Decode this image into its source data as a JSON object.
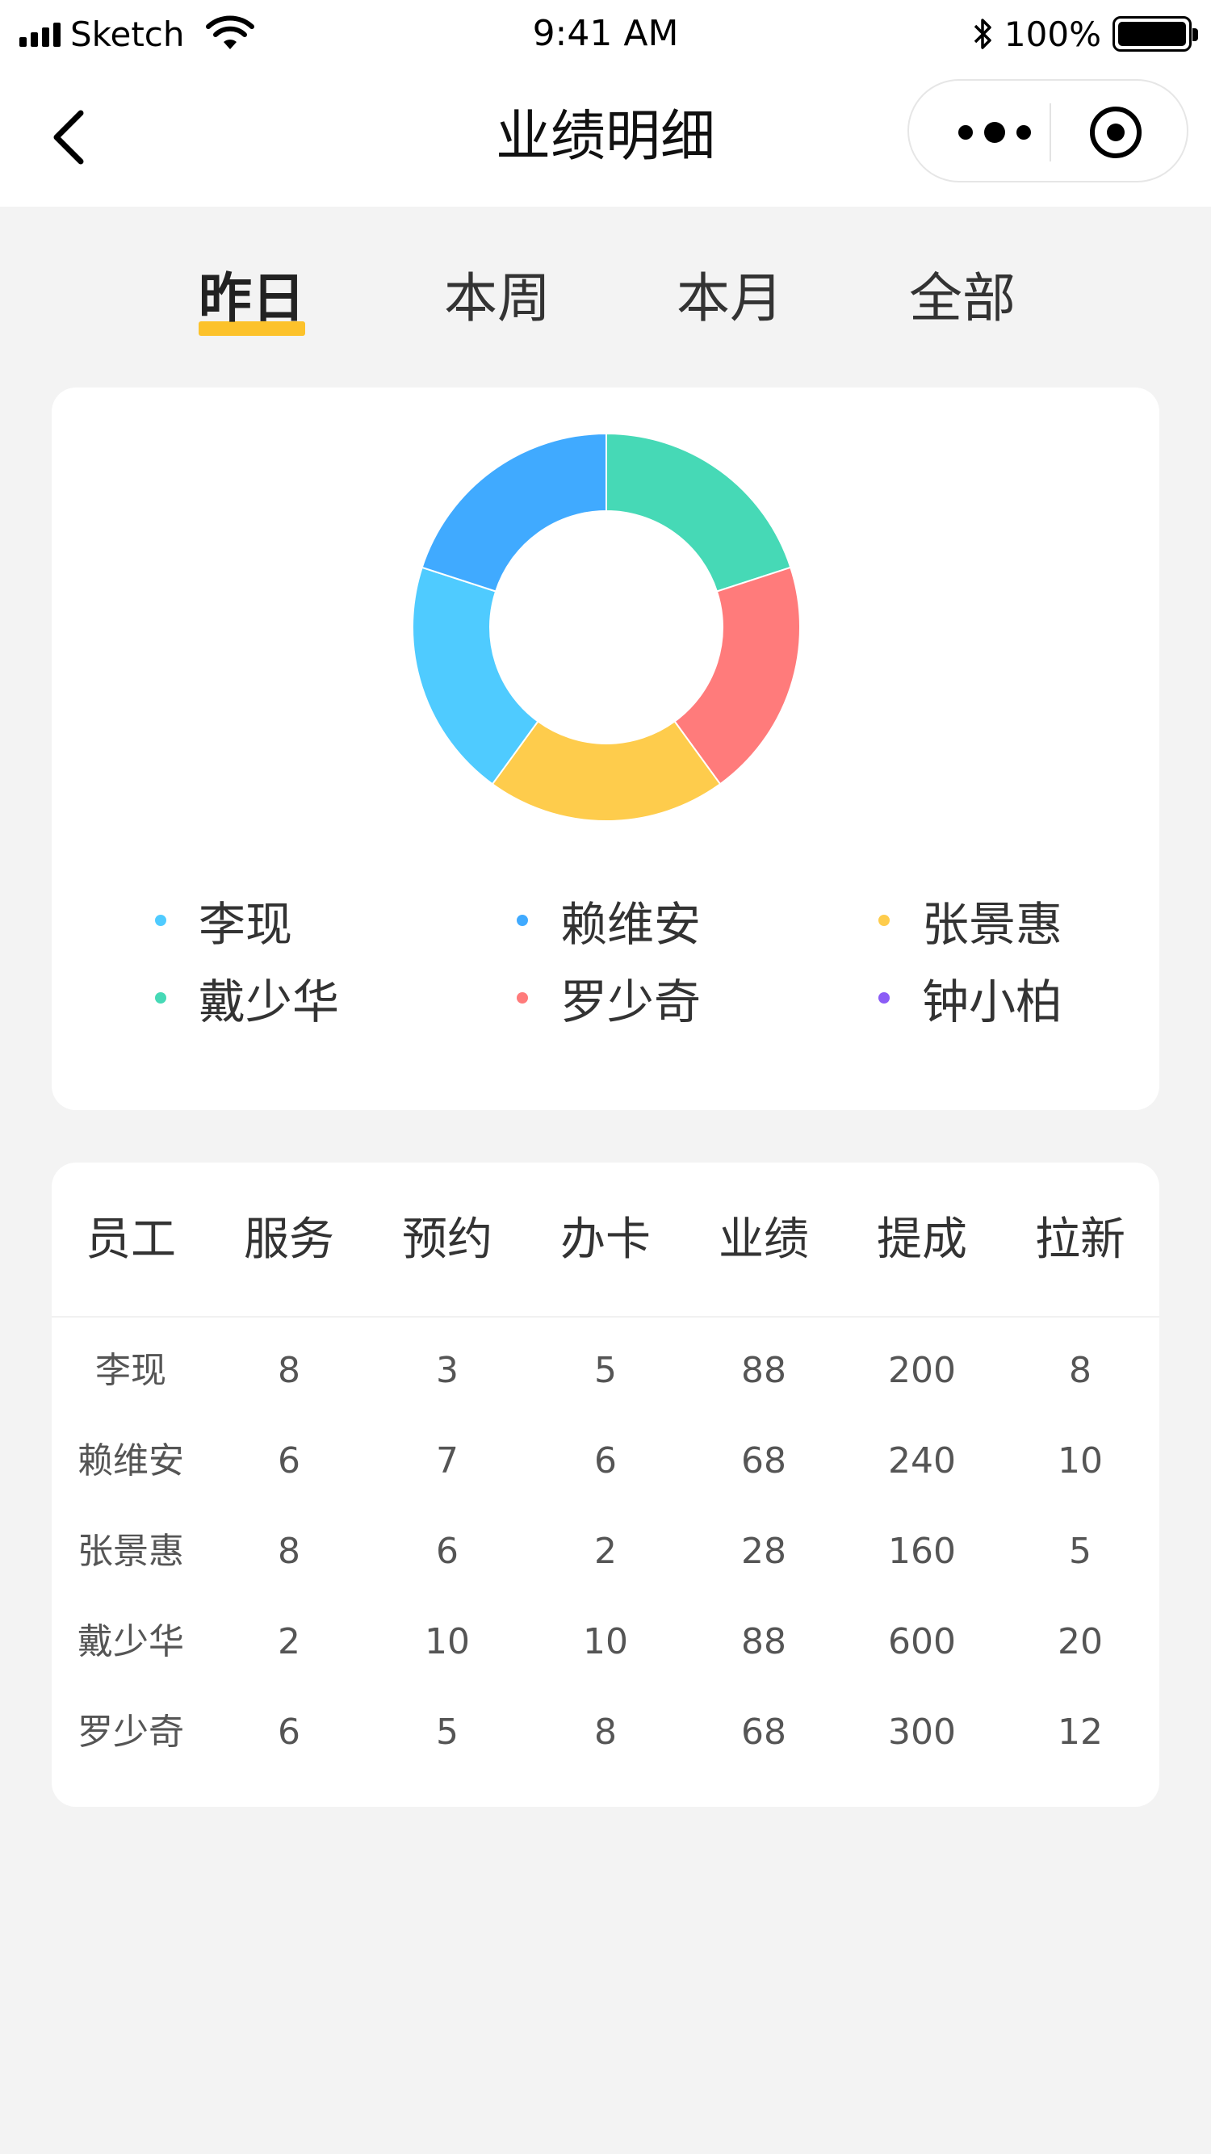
{
  "status_bar": {
    "carrier": "Sketch",
    "time": "9:41 AM",
    "battery": "100%"
  },
  "nav": {
    "title": "业绩明细"
  },
  "tabs": [
    {
      "label": "昨日",
      "active": true
    },
    {
      "label": "本周",
      "active": false
    },
    {
      "label": "本月",
      "active": false
    },
    {
      "label": "全部",
      "active": false
    }
  ],
  "chart_data": {
    "type": "pie",
    "donut": true,
    "slices": [
      {
        "name": "钟小柏",
        "value": 1,
        "color": "#46d9b6"
      },
      {
        "name": "罗少奇",
        "value": 1,
        "color": "#ff7b7b"
      },
      {
        "name": "张景惠",
        "value": 1,
        "color": "#fecc4c"
      },
      {
        "name": "李现",
        "value": 1,
        "color": "#4fcbff"
      },
      {
        "name": "赖维安",
        "value": 1,
        "color": "#40aaff"
      }
    ],
    "start_angle_deg": 0,
    "legend_placement": "bottom"
  },
  "legend": [
    {
      "name": "李现",
      "color": "#4fcbff"
    },
    {
      "name": "赖维安",
      "color": "#40aaff"
    },
    {
      "name": "张景惠",
      "color": "#fecc4c"
    },
    {
      "name": "戴少华",
      "color": "#46d9b6"
    },
    {
      "name": "罗少奇",
      "color": "#ff7b7b"
    },
    {
      "name": "钟小柏",
      "color": "#8b5cf6"
    }
  ],
  "table": {
    "headers": [
      "员工",
      "服务",
      "预约",
      "办卡",
      "业绩",
      "提成",
      "拉新"
    ],
    "rows": [
      [
        "李现",
        "8",
        "3",
        "5",
        "88",
        "200",
        "8"
      ],
      [
        "赖维安",
        "6",
        "7",
        "6",
        "68",
        "240",
        "10"
      ],
      [
        "张景惠",
        "8",
        "6",
        "2",
        "28",
        "160",
        "5"
      ],
      [
        "戴少华",
        "2",
        "10",
        "10",
        "88",
        "600",
        "20"
      ],
      [
        "罗少奇",
        "6",
        "5",
        "8",
        "68",
        "300",
        "12"
      ]
    ]
  }
}
